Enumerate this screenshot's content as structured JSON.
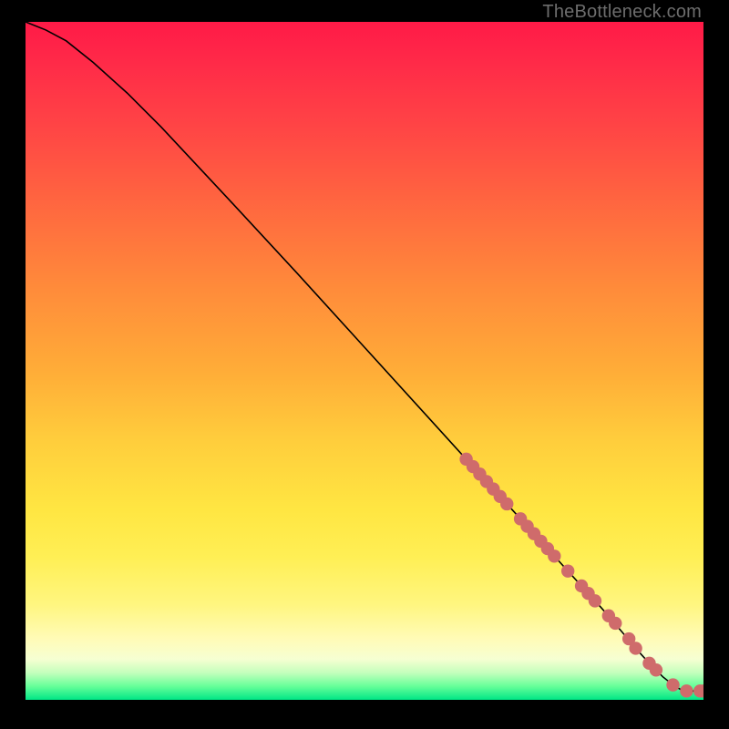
{
  "watermark": "TheBottleneck.com",
  "colors": {
    "gradient_top": "#ff1a47",
    "gradient_mid": "#ffe642",
    "gradient_bottom": "#00e686",
    "curve": "#000000",
    "marker": "#cf6b6b",
    "background": "#000000"
  },
  "chart_data": {
    "type": "line",
    "title": "",
    "xlabel": "",
    "ylabel": "",
    "xlim": [
      0,
      100
    ],
    "ylim": [
      0,
      100
    ],
    "grid": false,
    "legend": false,
    "series": [
      {
        "name": "curve",
        "x": [
          0,
          3,
          6,
          10,
          15,
          20,
          30,
          40,
          50,
          60,
          65,
          70,
          75,
          80,
          85,
          88,
          90,
          92,
          94,
          95.5,
          97,
          100
        ],
        "y": [
          100,
          98.8,
          97.2,
          94,
          89.5,
          84.5,
          73.8,
          63,
          52,
          41,
          35.5,
          30,
          24.5,
          19,
          13.5,
          10,
          7.6,
          5.4,
          3.4,
          2.2,
          1.3,
          1.3
        ]
      },
      {
        "name": "markers",
        "x": [
          65,
          66,
          67,
          68,
          69,
          70,
          71,
          73,
          74,
          75,
          76,
          77,
          78,
          80,
          82,
          83,
          84,
          86,
          87,
          89,
          90,
          92,
          93,
          95.5,
          97.5,
          99.5,
          100
        ],
        "y": [
          35.5,
          34.4,
          33.3,
          32.2,
          31.1,
          30,
          28.9,
          26.7,
          25.6,
          24.5,
          23.4,
          22.3,
          21.2,
          19,
          16.8,
          15.7,
          14.6,
          12.4,
          11.3,
          9,
          7.6,
          5.4,
          4.4,
          2.2,
          1.3,
          1.3,
          1.3
        ]
      }
    ]
  }
}
